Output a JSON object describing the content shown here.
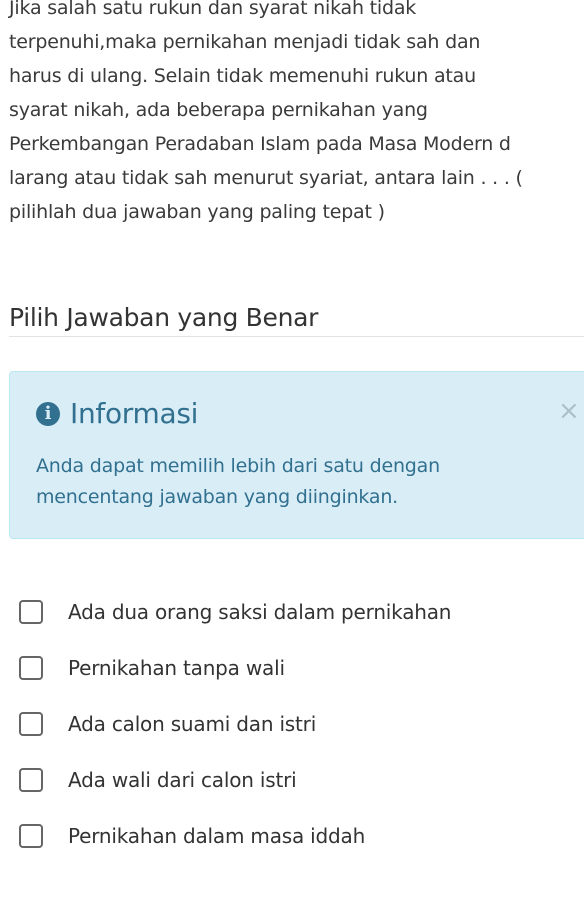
{
  "question": {
    "lines": [
      "Jika salah satu rukun dan syarat nikah tidak",
      "terpenuhi,maka pernikahan menjadi tidak sah dan",
      "harus di ulang. Selain tidak memenuhi rukun atau",
      "syarat nikah, ada beberapa pernikahan yang",
      "Perkembangan Peradaban Islam pada Masa Modern d",
      "larang atau tidak sah menurut syariat, antara lain  . . . (",
      "pilihlah dua jawaban yang paling tepat )"
    ]
  },
  "answer_section": {
    "title": "Pilih Jawaban yang Benar"
  },
  "info_alert": {
    "icon": "info-circle-icon",
    "heading": "Informasi",
    "body": "Anda dapat memilih lebih dari satu dengan mencentang jawaban yang diinginkan.",
    "close_symbol": "×",
    "colors": {
      "background": "#d9edf7",
      "border": "#bce8f1",
      "text": "#31708f"
    }
  },
  "options": [
    {
      "label": "Ada dua orang saksi dalam pernikahan",
      "checked": false
    },
    {
      "label": "Pernikahan tanpa wali",
      "checked": false
    },
    {
      "label": "Ada calon suami dan istri",
      "checked": false
    },
    {
      "label": "Ada wali dari calon istri",
      "checked": false
    },
    {
      "label": "Pernikahan dalam masa iddah",
      "checked": false
    }
  ]
}
